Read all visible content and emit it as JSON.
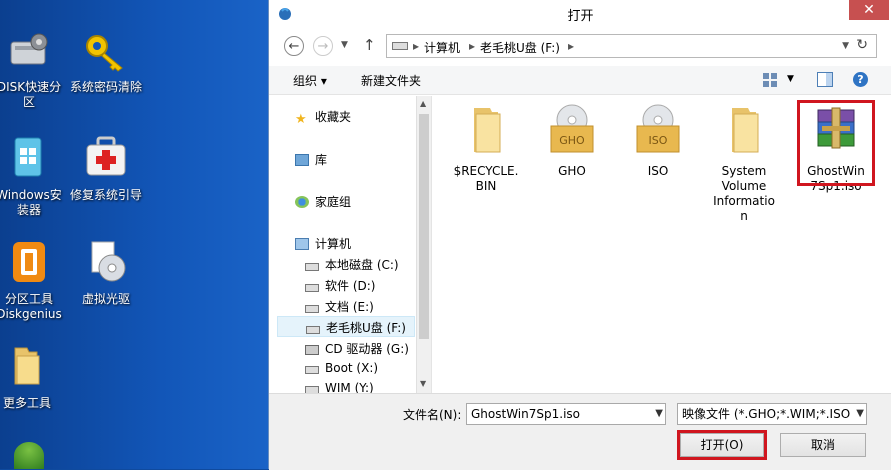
{
  "desktop": {
    "icons": [
      {
        "label": "DISK快速分区",
        "icon": "disk-tool-icon"
      },
      {
        "label": "系统密码清除",
        "icon": "key-icon"
      },
      {
        "label": "Windows安装器",
        "icon": "windows-installer-icon"
      },
      {
        "label": "修复系统引导",
        "icon": "first-aid-icon"
      },
      {
        "label": "分区工具Diskgenius",
        "icon": "diskgenius-icon"
      },
      {
        "label": "虚拟光驱",
        "icon": "virtual-drive-icon"
      },
      {
        "label": "更多工具",
        "icon": "folder-icon"
      }
    ]
  },
  "dialog": {
    "title": "打开",
    "close_label": "✕",
    "address": {
      "crumb1": "计算机",
      "crumb2": "老毛桃U盘 (F:)",
      "sep": "▸",
      "refresh": "↻"
    },
    "toolbar": {
      "organize": "组织 ▾",
      "new_folder": "新建文件夹",
      "help": "?"
    },
    "nav": {
      "favorites": "收藏夹",
      "libraries": "库",
      "homegroup": "家庭组",
      "computer": "计算机",
      "drives": [
        "本地磁盘 (C:)",
        "软件 (D:)",
        "文档 (E:)",
        "老毛桃U盘 (F:)",
        "CD 驱动器 (G:)",
        "Boot (X:)",
        "WIM (Y:)"
      ]
    },
    "files": [
      {
        "name": "$RECYCLE.BIN",
        "lines": [
          "$RECYCLE.",
          "BIN"
        ],
        "icon": "folder-icon"
      },
      {
        "name": "GHO",
        "lines": [
          "GHO"
        ],
        "icon": "gho-folder-icon",
        "badge": "GHO"
      },
      {
        "name": "ISO",
        "lines": [
          "ISO"
        ],
        "icon": "iso-folder-icon",
        "badge": "ISO"
      },
      {
        "name": "System Volume Information",
        "lines": [
          "System",
          "Volume",
          "Informatio",
          "n"
        ],
        "icon": "folder-icon"
      },
      {
        "name": "GhostWin7Sp1.iso",
        "lines": [
          "GhostWin",
          "7Sp1.iso"
        ],
        "icon": "winrar-archive-icon"
      }
    ],
    "filename_label": "文件名(N):",
    "filename_value": "GhostWin7Sp1.iso",
    "filetype_value": "映像文件 (*.GHO;*.WIM;*.ISO",
    "open_button": "打开(O)",
    "cancel_button": "取消"
  },
  "colors": {
    "highlight": "#d0161f",
    "desktop": "#1256b8",
    "selection": "#e5f3fb"
  }
}
